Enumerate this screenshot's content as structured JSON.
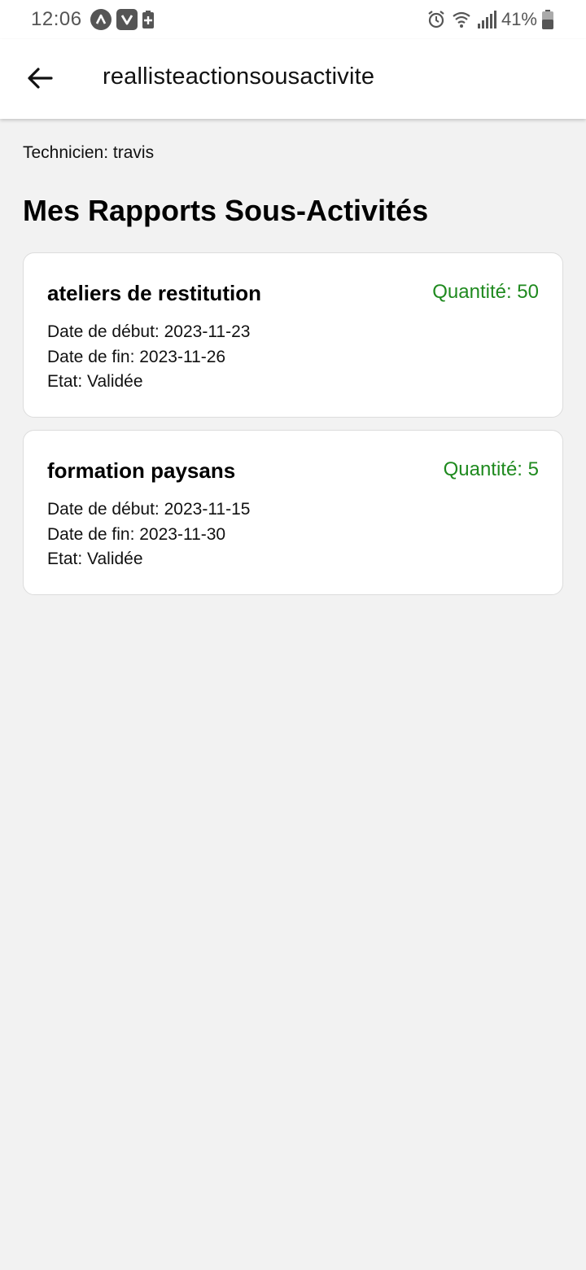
{
  "status_bar": {
    "time": "12:06",
    "battery_percent": "41%",
    "icons": [
      "android-auto-icon",
      "vpn-icon",
      "battery-saver-icon",
      "alarm-icon",
      "wifi-icon",
      "signal-icon",
      "battery-icon"
    ]
  },
  "app_bar": {
    "title": "reallisteactionsousactivite",
    "back_icon": "arrow-left-icon"
  },
  "technicien_line": "Technicien: travis",
  "section_title": "Mes Rapports Sous-Activités",
  "colors": {
    "quantity": "#1f8a1f",
    "background": "#f2f2f2",
    "card": "#ffffff"
  },
  "reports": [
    {
      "name": "ateliers de restitution",
      "quantity": "Quantité: 50",
      "start": "Date de début: 2023-11-23",
      "end": "Date de fin: 2023-11-26",
      "state": "Etat: Validée"
    },
    {
      "name": "formation paysans",
      "quantity": "Quantité: 5",
      "start": "Date de début: 2023-11-15",
      "end": "Date de fin: 2023-11-30",
      "state": "Etat: Validée"
    }
  ]
}
